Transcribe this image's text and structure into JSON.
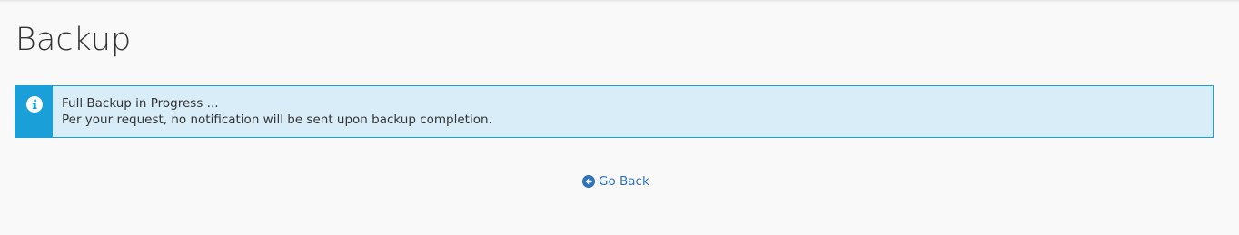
{
  "page": {
    "title": "Backup"
  },
  "alert": {
    "type": "info",
    "icon": "info-circle-icon",
    "line1": "Full Backup in Progress ...",
    "line2": "Per your request, no notification will be sent upon backup completion."
  },
  "go_back": {
    "icon": "arrow-circle-left-icon",
    "label": "Go Back"
  },
  "colors": {
    "background": "#f9f9f9",
    "alert_accent": "#1a9fd8",
    "alert_background": "#d8edf8",
    "link": "#2e72b9",
    "text": "#333333"
  }
}
